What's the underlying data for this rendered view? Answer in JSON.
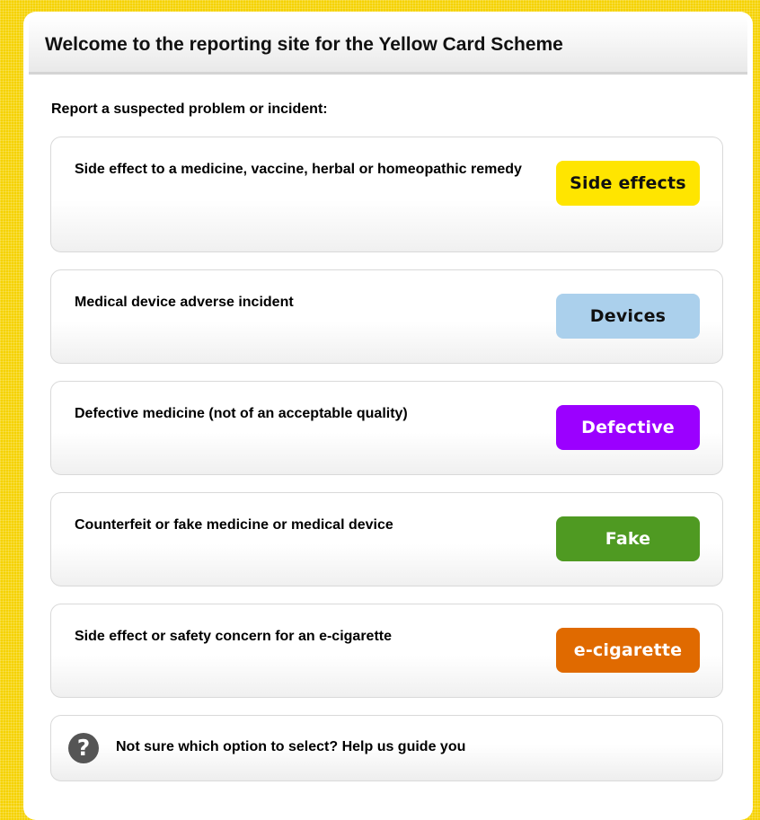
{
  "header": {
    "title": "Welcome to the reporting site for the Yellow Card Scheme"
  },
  "intro": "Report a suspected problem or incident:",
  "options": [
    {
      "text": "Side effect to a medicine, vaccine, herbal or homeopathic remedy",
      "button_label": "Side effects",
      "button_color": "#ffe500",
      "button_text_color": "#111111"
    },
    {
      "text": "Medical device adverse incident",
      "button_label": "Devices",
      "button_color": "#abd0ec",
      "button_text_color": "#111111"
    },
    {
      "text": "Defective medicine (not of an acceptable quality)",
      "button_label": "Defective",
      "button_color": "#9b00ff",
      "button_text_color": "#ffffff"
    },
    {
      "text": "Counterfeit or fake medicine or medical device",
      "button_label": "Fake",
      "button_color": "#4f9a22",
      "button_text_color": "#ffffff"
    },
    {
      "text": "Side effect or safety concern for an e-cigarette",
      "button_label": "e-cigarette",
      "button_color": "#e06a00",
      "button_text_color": "#ffffff"
    }
  ],
  "help": {
    "icon": "question-circle-icon",
    "text": "Not sure which option to select? Help us guide you"
  }
}
